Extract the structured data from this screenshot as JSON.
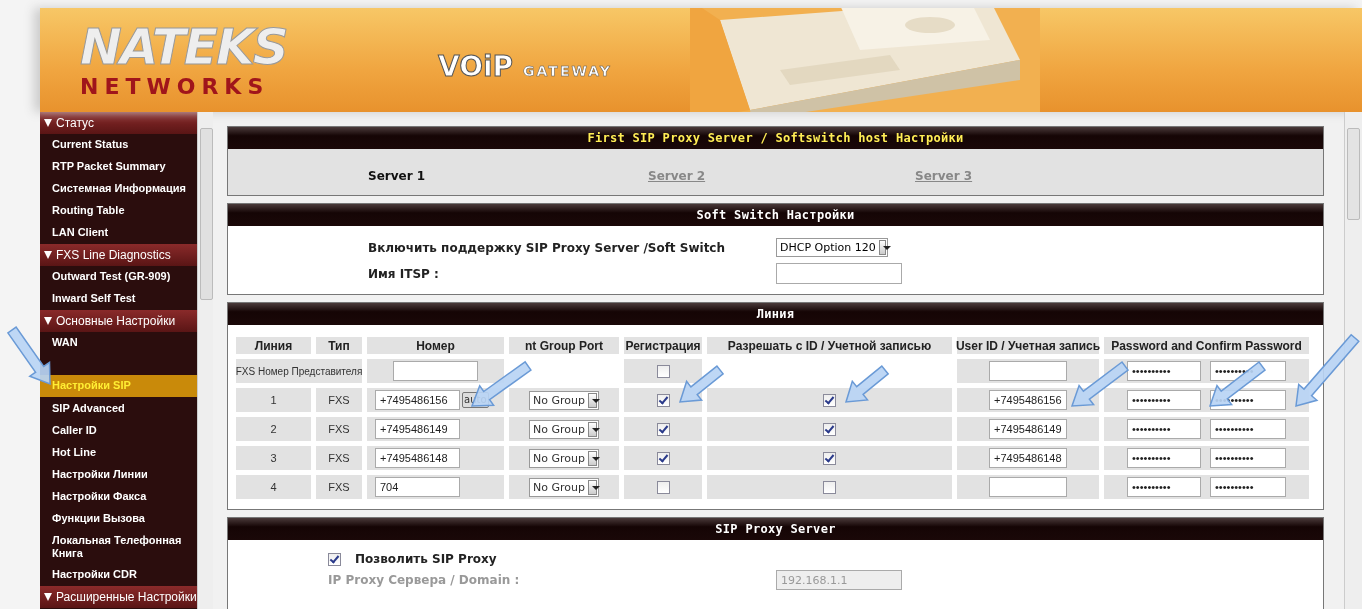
{
  "header": {
    "logo_top": "NATEKS",
    "logo_bottom": "NETWORKS",
    "product": "VOiP",
    "product_sub": "GATEWAY"
  },
  "sidebar": {
    "items": [
      {
        "kind": "section",
        "label": "Статус",
        "expanded": true
      },
      {
        "kind": "item",
        "label": "Current Status",
        "selected": false
      },
      {
        "kind": "item",
        "label": "RTP Packet Summary",
        "selected": false
      },
      {
        "kind": "item",
        "label": "Системная Информация",
        "selected": false
      },
      {
        "kind": "item",
        "label": "Routing Table",
        "selected": false
      },
      {
        "kind": "item",
        "label": "LAN Client",
        "selected": false
      },
      {
        "kind": "section",
        "label": "FXS Line Diagnostics",
        "expanded": true
      },
      {
        "kind": "item",
        "label": "Outward Test (GR-909)",
        "selected": false
      },
      {
        "kind": "item",
        "label": "Inward Self Test",
        "selected": false
      },
      {
        "kind": "section",
        "label": "Основные Настройки",
        "expanded": true
      },
      {
        "kind": "item",
        "label": "WAN",
        "selected": false
      },
      {
        "kind": "item",
        "label": "Настройки SIP",
        "selected": true
      },
      {
        "kind": "item",
        "label": "SIP Advanced",
        "selected": false
      },
      {
        "kind": "item",
        "label": "Caller ID",
        "selected": false
      },
      {
        "kind": "item",
        "label": "Hot Line",
        "selected": false
      },
      {
        "kind": "item",
        "label": "Настройки Линии",
        "selected": false
      },
      {
        "kind": "item",
        "label": "Настройки Факса",
        "selected": false
      },
      {
        "kind": "item",
        "label": "Функции Вызова",
        "selected": false
      },
      {
        "kind": "item",
        "label": "Локальная Телефонная Книга",
        "selected": false
      },
      {
        "kind": "item",
        "label": "Настройки CDR",
        "selected": false
      },
      {
        "kind": "section",
        "label": "Расширенные Настройки",
        "expanded": true
      }
    ]
  },
  "proxy_server_panel": {
    "title": "First SIP Proxy Server / Softswitch host Настройки",
    "tabs": [
      {
        "label": "Server 1",
        "selected": true
      },
      {
        "label": "Server 2",
        "selected": false
      },
      {
        "label": "Server 3",
        "selected": false
      }
    ]
  },
  "softswitch_panel": {
    "title": "Soft Switch Настройки",
    "enable_label": "Включить поддержку SIP Proxy Server /Soft Switch",
    "enable_value": "DHCP Option 120",
    "itsp_label": "Имя ITSP :"
  },
  "line_panel": {
    "title": "Линия",
    "columns": [
      "Линия",
      "Тип",
      "Номер",
      "nt Group Port",
      "Регистрация",
      "Разрешать с ID / Учетной записью",
      "User ID / Учетная запись",
      "Password and Confirm Password"
    ],
    "representative": {
      "label": "FXS Номер Представителя",
      "registration": false,
      "password": "••••••••••",
      "confirm": "••••••••••"
    },
    "rows": [
      {
        "line": "1",
        "type": "FXS",
        "number": "+7495486156",
        "auto": "auto",
        "group": "No Group",
        "registration": true,
        "allow": true,
        "user_id": "+7495486156",
        "password": "••••••••••",
        "confirm": "••••••••••"
      },
      {
        "line": "2",
        "type": "FXS",
        "number": "+7495486149",
        "group": "No Group",
        "registration": true,
        "allow": true,
        "user_id": "+7495486149",
        "password": "••••••••••",
        "confirm": "••••••••••"
      },
      {
        "line": "3",
        "type": "FXS",
        "number": "+7495486148",
        "group": "No Group",
        "registration": true,
        "allow": true,
        "user_id": "+7495486148",
        "password": "••••••••••",
        "confirm": "••••••••••"
      },
      {
        "line": "4",
        "type": "FXS",
        "number": "704",
        "group": "No Group",
        "registration": false,
        "allow": false,
        "password": "••••••••••",
        "confirm": "••••••••••"
      }
    ]
  },
  "sip_proxy_panel": {
    "title": "SIP Proxy Server",
    "allow_label": "Позволить SIP Proxy",
    "allow_checked": true,
    "ip_label": "IP Proxy Сервера / Domain :",
    "ip_value": "192.168.1.1",
    "ip_disabled": true
  }
}
